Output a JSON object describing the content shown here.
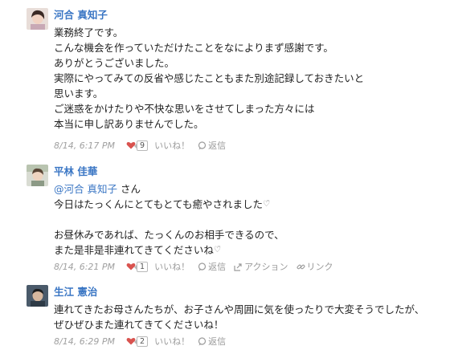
{
  "posts": [
    {
      "author": "河合 真知子",
      "lines": [
        "業務終了です。",
        "こんな機会を作っていただけたことをなによりまず感謝です。",
        "ありがとうございました。",
        "実際にやってみての反省や感じたこともまた別途記録しておきたいと",
        "思います。",
        "ご迷惑をかけたりや不快な思いをさせてしまった方々には",
        "本当に申し訳ありませんでした。"
      ],
      "timestamp": "8/14, 6:17 PM",
      "like_count": "9",
      "like_label": "いいね！",
      "reply_label": "返信"
    },
    {
      "author": "平林 佳華",
      "mention": "@河合 真知子",
      "mention_suffix": " さん",
      "lines": [
        "今日はたっくんにとてもとても癒やされました",
        "",
        "お昼休みであれば、たっくんのお相手できるので、",
        "また是非是非連れてきてくださいね"
      ],
      "timestamp": "8/14, 6:21 PM",
      "like_count": "1",
      "like_label": "いいね！",
      "reply_label": "返信",
      "action_label": "アクション",
      "link_label": "リンク"
    },
    {
      "author": "生江 憲治",
      "lines": [
        "連れてきたお母さんたちが、お子さんや周囲に気を使ったりで大変そうでしたが、",
        "ぜひぜひまた連れてきてくださいね！"
      ],
      "timestamp": "8/14, 6:29 PM",
      "like_count": "2",
      "like_label": "いいね！",
      "reply_label": "返信"
    }
  ],
  "colors": {
    "author": "#3a76c4",
    "heart": "#d9534f",
    "meta": "#9a9a9a"
  },
  "icons": [
    "heart-icon",
    "reply-bubble-icon",
    "share-action-icon",
    "link-icon",
    "sparkle-hearts-icon"
  ]
}
